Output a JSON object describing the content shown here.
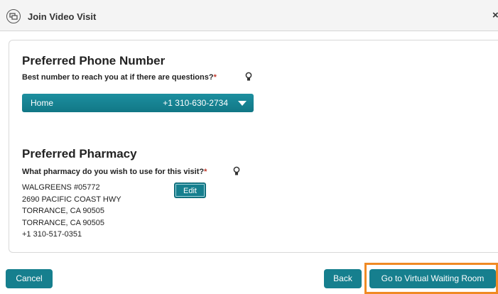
{
  "window": {
    "title": "Join Video Visit",
    "close_glyph": "×",
    "icon": "video-visit-icon"
  },
  "phone_section": {
    "heading": "Preferred Phone Number",
    "question": "Best number to reach you at if there are questions?",
    "required_mark": "*",
    "help_icon": "lightbulb-icon",
    "select": {
      "label": "Home",
      "number": "+1 310-630-2734"
    }
  },
  "pharmacy_section": {
    "heading": "Preferred Pharmacy",
    "question": "What pharmacy do you wish to use for this visit?",
    "required_mark": "*",
    "help_icon": "lightbulb-icon",
    "address_lines": [
      "WALGREENS #05772",
      "2690 PACIFIC COAST HWY",
      "TORRANCE, CA 90505",
      "TORRANCE, CA 90505",
      "+1 310-517-0351"
    ],
    "edit_label": "Edit"
  },
  "footer": {
    "cancel_label": "Cancel",
    "back_label": "Back",
    "waiting_room_label": "Go to Virtual Waiting Room"
  },
  "colors": {
    "accent": "#167f8e",
    "required": "#c0392b",
    "highlight": "#f08a24"
  }
}
